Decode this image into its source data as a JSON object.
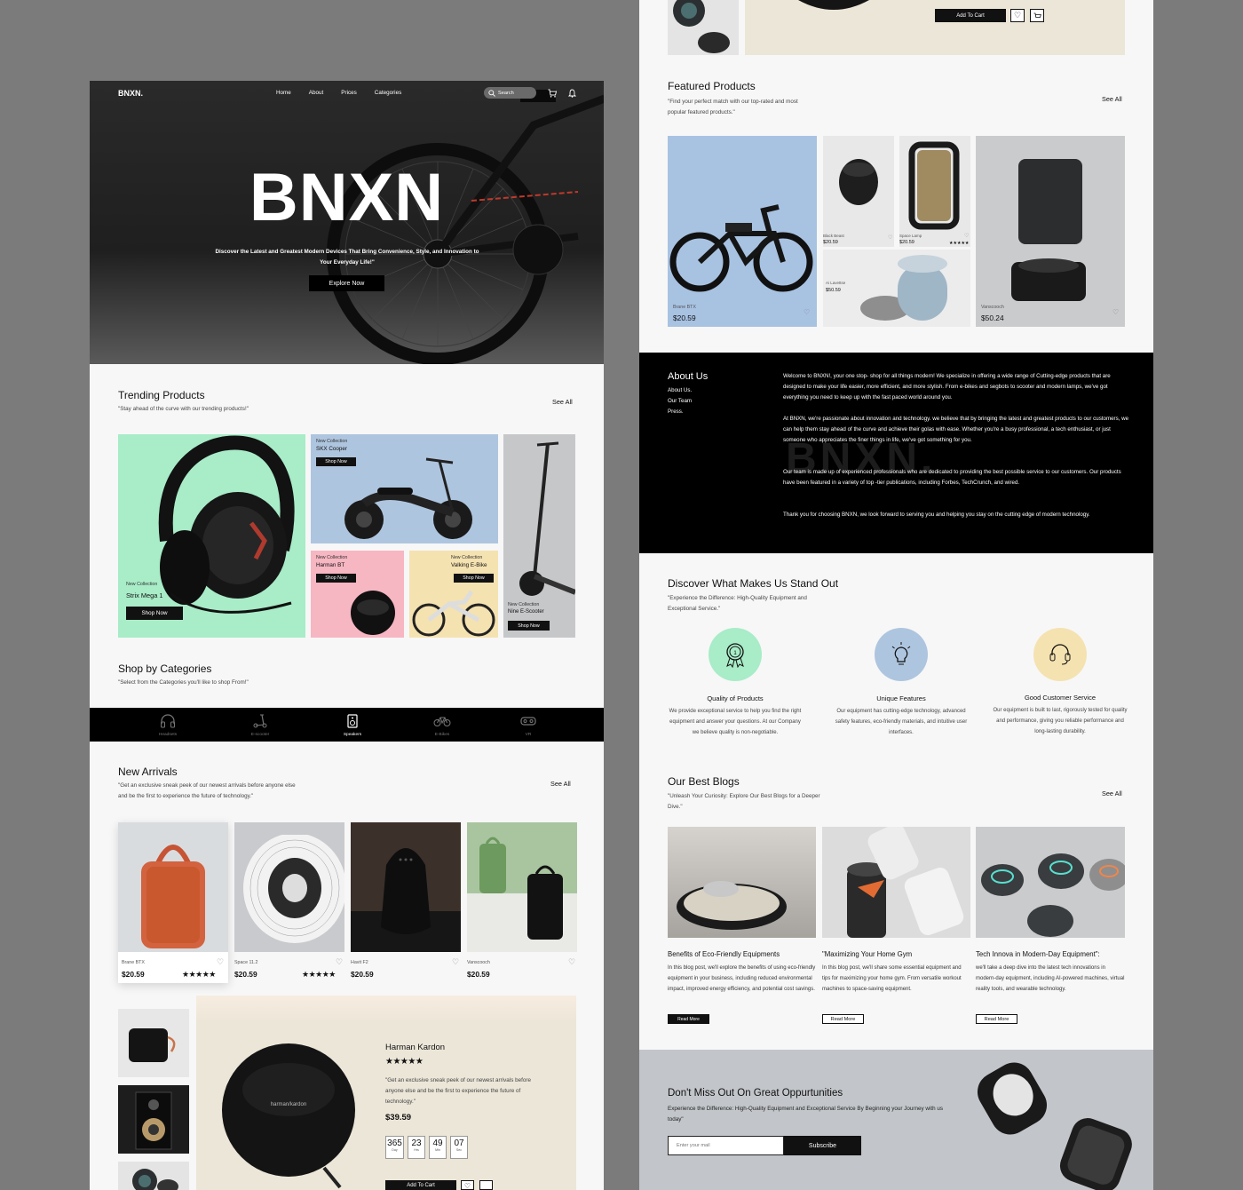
{
  "colors": {
    "mint": "#a8ecc8",
    "sky": "#aec5df",
    "pink": "#f6b6c2",
    "sand": "#f5e2b1",
    "grey": "#c5c7c9",
    "black": "#111111",
    "cream": "#ece6d8",
    "footer": "#c2c5c9"
  },
  "nav": {
    "logo": "BNXN.",
    "links": [
      "Home",
      "About",
      "Prices",
      "Categories"
    ],
    "search_placeholder": "Search"
  },
  "hero": {
    "title": "BNXN",
    "tagline": "Discover the Latest and Greatest Modern Devices That Bring Convenience, Style, and Innovation to Your Everyday Life!\"",
    "cta": "Explore Now"
  },
  "trending": {
    "title": "Trending Products",
    "subtitle": "\"Stay ahead of the curve with our trending products!\"",
    "see_all": "See All",
    "tiles": [
      {
        "tag": "New Collection",
        "name": "Strix Mega 1",
        "button": "Shop Now"
      },
      {
        "tag": "New Collection",
        "name": "SKX Cooper",
        "button": "Shop Now"
      },
      {
        "tag": "New Collection",
        "name": "Harman BT",
        "button": "Shop Now"
      },
      {
        "tag": "New Collection",
        "name": "Valking E-Bike",
        "button": "Shop Now"
      },
      {
        "tag": "New Collection",
        "name": "Nine E-Scooter",
        "button": "Shop Now"
      }
    ]
  },
  "categories": {
    "title": "Shop by Categories",
    "subtitle": "\"Select from the Categories you'll like to shop From!\"",
    "items": [
      "Headsets",
      "E-scooter",
      "Speakers",
      "E-Bikes",
      "VR"
    ]
  },
  "new_arrivals": {
    "title": "New Arrivals",
    "subtitle_line1": "\"Get an exclusive sneak peek of our newest arrivals before anyone else",
    "subtitle_line2": "and be the first to experience the future of technology.\"",
    "see_all": "See All",
    "items": [
      {
        "name": "Brane BTX",
        "price": "$20.59",
        "stars": "★★★★★"
      },
      {
        "name": "Space  11.2",
        "price": "$20.59",
        "stars": "★★★★★"
      },
      {
        "name": "Havit F2",
        "price": "$20.59",
        "stars": ""
      },
      {
        "name": "Vanscooch",
        "price": "$20.59",
        "stars": ""
      }
    ]
  },
  "deal": {
    "name": "Harman Kardon",
    "stars": "★★★★★",
    "desc": "\"Get an exclusive sneak peek of our newest arrivals before anyone else and be the first to experience the future of technology.\"",
    "price": "$39.59",
    "countdown": [
      {
        "value": "365",
        "unit": "Day"
      },
      {
        "value": "23",
        "unit": "Hrs"
      },
      {
        "value": "49",
        "unit": "Min"
      },
      {
        "value": "07",
        "unit": "Sec"
      }
    ],
    "add_to_cart": "Add To Cart"
  },
  "top_strip": {
    "add_to_cart": "Add To Cart"
  },
  "featured": {
    "title": "Featured Products",
    "subtitle_line1": "\"Find your perfect match with our top-rated and most",
    "subtitle_line2": "popular featured products.\"",
    "see_all": "See All",
    "items": [
      {
        "name": "Brane BTX",
        "price": "$20.59"
      },
      {
        "name": "Black Beast",
        "price": "$20.59"
      },
      {
        "name": "Space  Lamp",
        "price": "$20.59",
        "stars": "★★★★★"
      },
      {
        "name": "Ai Lavettse",
        "price": "$50.59"
      },
      {
        "name": "Vanscooch",
        "price": "$50.24"
      }
    ]
  },
  "about": {
    "title": "About Us",
    "links": [
      "About Us.",
      "Our Team",
      "Press."
    ],
    "watermark": "BNXN.",
    "paragraphs": [
      "Welcome to BNXN!, your one stop- shop for all things modern! We specialize in offering a wide range of Cutting-edge products that are designed to make your life easier, more efficient, and more stylish. From e-bikes and segbots to scooter and modern lamps, we've got everything you need to keep up with the fast paced world around you.",
      "At BNXN, we're passionate about innovation and technology. we believe that by bringing the latest and greatest products to our customers, we can help them stay ahead of the curve and achieve their golas with ease. Whether you're a busy professional, a tech enthusiast, or just someone who appreciates the finer things in life, we've got something for you.",
      "Our team is made up of experienced professionals who are dedicated to providing the best possible service to our customers. Our products have been featured in a variety of top -tier publications, including Forbes, TechCrunch, and wired.",
      "Thank you for choosing BNXN, we look forward to serving you and helping you stay on the cutting edge of modern technology."
    ]
  },
  "standout": {
    "title": "Discover What Makes Us Stand Out",
    "subtitle_line1": "\"Experience the Difference: High-Quality Equipment and",
    "subtitle_line2": "Exceptional Service.\"",
    "features": [
      {
        "icon": "award-icon",
        "title": "Quality of Products",
        "text": "We provide exceptional service to help you find the right equipment and answer your questions. At our Company we believe quality is non-negotiable."
      },
      {
        "icon": "lightbulb-icon",
        "title": "Unique Features",
        "text": "Our equipment has cutting-edge technology, advanced safety features, eco-friendly materials, and intuitive user interfaces."
      },
      {
        "icon": "headset-icon",
        "title": "Good Customer Service",
        "text": "Our equipment is built to last, rigorously tested for quality and performance, giving you reliable performance and long-lasting durability."
      }
    ]
  },
  "blogs": {
    "title": "Our Best Blogs",
    "subtitle_line1": "\"Unleash Your Curiosity: Explore Our Best Blogs for a Deeper",
    "subtitle_line2": "Dive.\"",
    "see_all": "See All",
    "posts": [
      {
        "title": "Benefits of Eco-Friendly Equipments",
        "text": "In this blog post, we'll explore the benefits of using eco-friendly equipment in your business, including reduced environmental impact, improved energy efficiency, and potential cost savings.",
        "button": "Read More"
      },
      {
        "title": "\"Maximizing Your Home Gym",
        "text": "In this blog post, we'll share some essential equipment and tips for maximizing your home gym. From versatile workout machines to space-saving equipment.",
        "button": "Read More"
      },
      {
        "title": "Tech Innova in Modern-Day Equipment\":",
        "text": "we'll take a deep dive into the latest tech innovations in modern-day equipment, including AI-powered machines, virtual reality tools, and wearable technology.",
        "button": "Read More"
      }
    ]
  },
  "newsletter": {
    "title": "Don't Miss Out On Great Oppurtunities",
    "subtitle": "Experience the Difference: High-Quality Equipment and Exceptional Service By Beginning your Journey with us today\"",
    "placeholder": "Enter your mail",
    "button": "Subscribe"
  }
}
